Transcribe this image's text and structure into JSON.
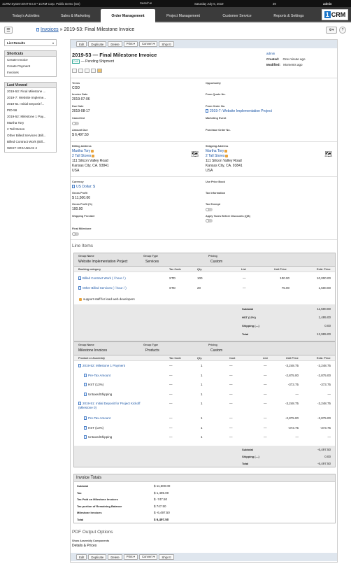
{
  "sysbar": {
    "app": "1CRM System ENT-8.6.0 • 1CRM Corp. Public Demo (SU)",
    "search": "Search ▾",
    "date": "Saturday July 6, 2019",
    "count": "39",
    "user": "admin"
  },
  "nav": {
    "tabs": [
      "Today's Activities",
      "Sales & Marketing",
      "Order Management",
      "Project Management",
      "Customer Service",
      "Reports & Settings"
    ],
    "logo": "CRM",
    "logo_num": "1"
  },
  "breadcrumb": {
    "module": "Invoices",
    "sep": "»",
    "title": "2019-53: Final Milestone Invoice"
  },
  "sidebar": {
    "list_results": "List Results",
    "shortcuts_title": "Shortcuts",
    "shortcuts": [
      "Create Invoice",
      "Create Payment",
      "Invoices"
    ],
    "last_viewed_title": "Last Viewed",
    "last_viewed": [
      "2019-53: Final Milestone ...",
      "2019-7: Website Impleme...",
      "2019-51: Initial Deposit f...",
      "PID-56",
      "2019-52: Milestone 1 Pay...",
      "Martha Tory",
      "2 Tall Stores",
      "Other Billed Services (Bill...",
      "Billed Contract Work (Bill...",
      "WEST ARKANSAS 2"
    ]
  },
  "toolbar": {
    "edit": "Edit",
    "duplicate": "Duplicate",
    "delete": "Delete",
    "print": "Print ▾",
    "convert": "Convert ▾",
    "ship": "Ship It!"
  },
  "header": {
    "title": "2019-53 — Final Milestone Invoice",
    "badge": "DUE",
    "status": "— Pending Shipment",
    "owner": "admin",
    "created_label": "Created:",
    "created": "One minute ago",
    "modified_label": "Modified:",
    "modified": "Moments ago"
  },
  "fields": {
    "terms_l": "Terms",
    "terms": "COD",
    "opportunity_l": "Opportunity",
    "invoice_date_l": "Invoice Date",
    "invoice_date": "2019-07-06",
    "from_quote_l": "From Quote No.",
    "due_date_l": "Due Date",
    "due_date": "2019-08-17",
    "from_order_l": "From Order No.",
    "from_order": "2019-7: Website Implementation Project",
    "cancelled_l": "Cancelled",
    "marketing_l": "Marketing Event",
    "amount_due_l": "Amount Due",
    "amount_due": "$ 6,497.50",
    "purchase_order_l": "Purchase Order No.",
    "billing_l": "Billing Address",
    "billing_contact": "Martha Tory",
    "billing_account": "2 Tall Stores",
    "billing_street": "111 Silicon Valley Road",
    "billing_city": "Kansas City, CA. 93841",
    "billing_country": "USA",
    "shipping_l": "Shipping Address",
    "shipping_contact": "Martha Tory",
    "shipping_account": "2 Tall Stores",
    "shipping_street": "111 Silicon Valley Road",
    "shipping_city": "Kansas City, CA. 93841",
    "shipping_country": "USA",
    "currency_l": "Currency",
    "currency": "US Dollar: $",
    "price_book_l": "Use Price Book",
    "gross_profit_l": "Gross Profit",
    "gross_profit": "$ 11,500.00",
    "tax_info_l": "Tax Information",
    "gross_pct_l": "Gross Profit (%)",
    "gross_pct": "100.00",
    "tax_exempt_l": "Tax Exempt",
    "shipping_provider_l": "Shipping Provider",
    "apply_taxes_l": "Apply Taxes Before Discounts (QB)",
    "final_milestone_l": "Final Milestone"
  },
  "line_items": {
    "title": "Line Items",
    "group1": {
      "group_name_l": "Group Name",
      "group_name": "Website Implementation Project",
      "group_type_l": "Group Type",
      "group_type": "Services",
      "pricing_l": "Pricing",
      "pricing": "Custom",
      "cols": [
        "Booking category",
        "Tax Code",
        "Qty.",
        "List",
        "Unit Price",
        "Extd. Price"
      ],
      "rows": [
        {
          "name": "Billed Contract Work ( / hour / )",
          "tax": "STD",
          "qty": "100",
          "list": "—",
          "unit": "100.00",
          "ext": "10,000.00"
        },
        {
          "name": "Other Billed Services ( / hour / )",
          "tax": "STD",
          "qty": "20",
          "list": "—",
          "unit": "75.00",
          "ext": "1,500.00"
        }
      ],
      "note": "support staff for lead web developers",
      "totals": [
        {
          "label": "Subtotal",
          "value": "11,500.00"
        },
        {
          "label": "HST (13%)",
          "value": "1,495.00"
        },
        {
          "label": "Shipping (---)",
          "value": "0.00"
        },
        {
          "label": "Total",
          "value": "12,995.00"
        }
      ]
    },
    "group2": {
      "group_name_l": "Group Name",
      "group_name": "Milestone Invoices",
      "group_type_l": "Group Type",
      "group_type": "Products",
      "pricing_l": "Pricing",
      "pricing": "Custom",
      "cols": [
        "Product or Assembly",
        "Tax Code",
        "Qty.",
        "Cost",
        "List",
        "Unit Price",
        "Extd. Price"
      ],
      "rows": [
        {
          "name": "2019-52: Milestone 1 Payment",
          "indent": 0,
          "link": true,
          "tax": "—",
          "qty": "1",
          "cost": "—",
          "list": "—",
          "unit": "-3,248.75",
          "ext": "-3,248.75"
        },
        {
          "name": "Pre-Tax Amount",
          "indent": 1,
          "link": true,
          "tax": "—",
          "qty": "1",
          "cost": "—",
          "list": "—",
          "unit": "-2,875.00",
          "ext": "-2,875.00"
        },
        {
          "name": "HST (13%)",
          "indent": 1,
          "link": false,
          "tax": "—",
          "qty": "1",
          "cost": "—",
          "list": "—",
          "unit": "-373.75",
          "ext": "-373.75"
        },
        {
          "name": "UntaxedShipping",
          "indent": 1,
          "link": false,
          "tax": "—",
          "qty": "1",
          "cost": "—",
          "list": "—",
          "unit": "—",
          "ext": "—"
        },
        {
          "name": "2019-51: Initial Deposit for Project Kickoff (Milestone 0)",
          "indent": 0,
          "link": true,
          "tax": "—",
          "qty": "1",
          "cost": "—",
          "list": "—",
          "unit": "-3,248.75",
          "ext": "-3,248.75"
        },
        {
          "name": "Pre-Tax Amount",
          "indent": 1,
          "link": true,
          "tax": "—",
          "qty": "1",
          "cost": "—",
          "list": "—",
          "unit": "-2,875.00",
          "ext": "-2,875.00"
        },
        {
          "name": "HST (13%)",
          "indent": 1,
          "link": false,
          "tax": "—",
          "qty": "1",
          "cost": "—",
          "list": "—",
          "unit": "-373.75",
          "ext": "-373.75"
        },
        {
          "name": "UntaxedShipping",
          "indent": 1,
          "link": false,
          "tax": "—",
          "qty": "1",
          "cost": "—",
          "list": "—",
          "unit": "—",
          "ext": "—"
        }
      ],
      "totals": [
        {
          "label": "Subtotal",
          "value": "-6,497.50"
        },
        {
          "label": "Shipping (---)",
          "value": "0.00"
        },
        {
          "label": "Total",
          "value": "-6,497.50"
        }
      ]
    }
  },
  "invoice_totals": {
    "title": "Invoice Totals",
    "rows": [
      {
        "label": "Subtotal",
        "value": "$ 11,500.00"
      },
      {
        "label": "Tax",
        "value": "$ 1,495.00"
      },
      {
        "label": "Tax Paid on Milestone Invoices",
        "value": "$ -747.50"
      },
      {
        "label": "Tax portion of Remaining Balance",
        "value": "$ 747.50"
      },
      {
        "label": "Milestone Invoices",
        "value": "$ -6,497.50"
      },
      {
        "label": "Total",
        "value": "$ 6,497.50"
      }
    ]
  },
  "pdf_options": {
    "title": "PDF Output Options",
    "show_label": "Show Assembly Components",
    "show_value": "Details & Prices"
  }
}
